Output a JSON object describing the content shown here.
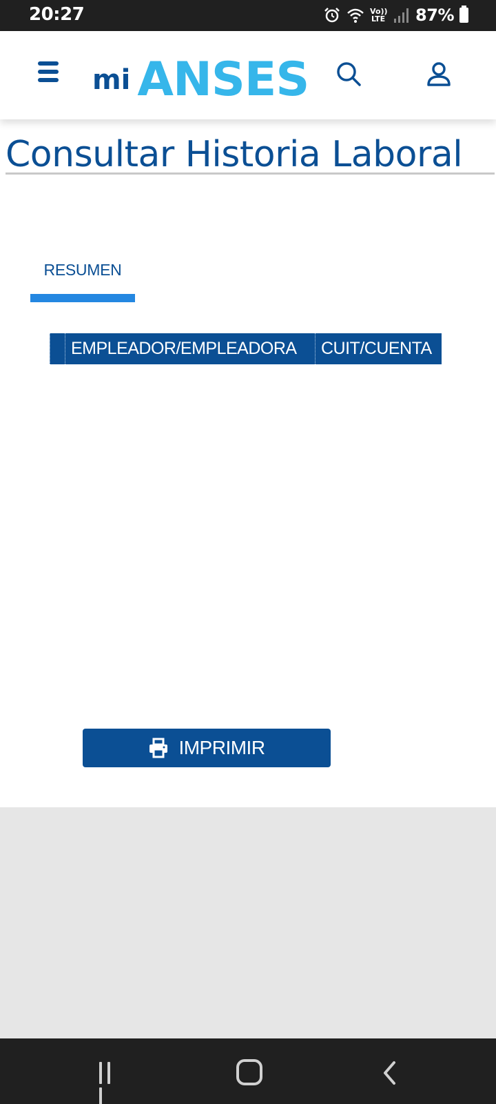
{
  "status_bar": {
    "time": "20:27",
    "lte_top": "Vo))",
    "lte_bottom": "LTE",
    "battery": "87%",
    "icons": [
      "alarm-icon",
      "wifi-icon",
      "volte-icon",
      "signal-icon",
      "battery-icon"
    ]
  },
  "header": {
    "logo_mi": "mi",
    "logo_brand": "ANSES",
    "icons": [
      "menu-icon",
      "search-icon",
      "user-icon"
    ]
  },
  "page": {
    "title": "Consultar Historia Laboral"
  },
  "tabs": [
    {
      "label": "RESUMEN",
      "active": true
    }
  ],
  "table": {
    "columns": [
      "",
      "EMPLEADOR/EMPLEADORA",
      "CUIT/CUENTA"
    ]
  },
  "actions": {
    "print_label": "IMPRIMIR",
    "print_icon": "printer-icon"
  },
  "navigation": {
    "icons": [
      "recents-icon",
      "home-icon",
      "back-icon"
    ]
  },
  "colors": {
    "primary": "#0b4f94",
    "brand_light": "#36b6ea",
    "tab_indicator": "#2487e1",
    "footer_bg": "#e6e6e6",
    "system_bar": "#202020"
  }
}
